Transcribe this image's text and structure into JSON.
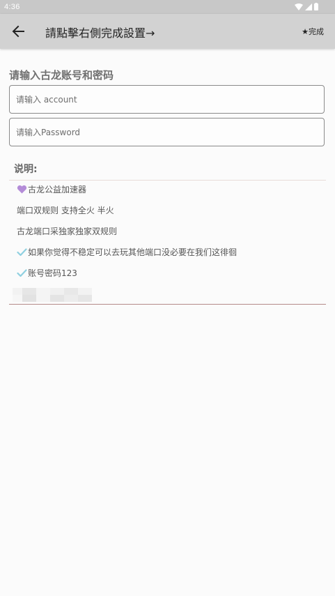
{
  "status_bar": {
    "time": "4:36"
  },
  "app_bar": {
    "title": "請點擊右側完成設置→",
    "done_label": "★完成"
  },
  "form": {
    "heading": "请输入古龙账号和密码",
    "account_placeholder": "请输入 account",
    "password_placeholder": "请输入Password"
  },
  "notes": {
    "heading": "说明:",
    "items": [
      {
        "icon": "purple-heart-icon",
        "text": "古龙公益加速器"
      },
      {
        "icon": "",
        "text": "端口双规则 支持全火 半火"
      },
      {
        "icon": "",
        "text": "古龙端口采独家独家双规则"
      },
      {
        "icon": "check-mark-icon",
        "text": "如果你觉得不稳定可以去玩其他端口没必要在我们这徘徊"
      },
      {
        "icon": "check-mark-icon",
        "text": "账号密码123"
      }
    ]
  },
  "colors": {
    "app_bar": "#d2d2d2",
    "status_bar": "#c8c8c8",
    "heart": "#b48cd8",
    "check": "#8fd0e0",
    "divider_bottom": "#b58a88"
  }
}
